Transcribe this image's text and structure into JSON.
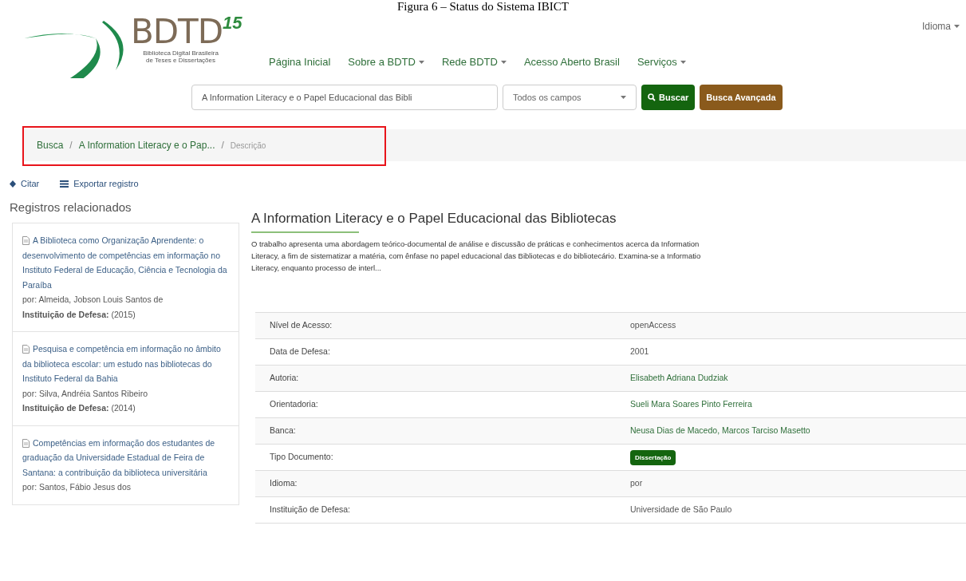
{
  "caption": "Figura 6 – Status do Sistema IBICT",
  "logo": {
    "name": "BDTD",
    "superscript": "15",
    "subtitle": [
      "Biblioteca Digital Brasileira",
      "de Teses e Dissertações"
    ]
  },
  "language_menu": {
    "label": "Idioma"
  },
  "nav": [
    {
      "label": "Página Inicial",
      "dropdown": false
    },
    {
      "label": "Sobre a BDTD",
      "dropdown": true
    },
    {
      "label": "Rede BDTD",
      "dropdown": true
    },
    {
      "label": "Acesso Aberto Brasil",
      "dropdown": false
    },
    {
      "label": "Serviços",
      "dropdown": true
    }
  ],
  "search": {
    "value": "A Information Literacy e o Papel Educacional das Bibli",
    "field": "Todos os campos",
    "search_button": "Buscar",
    "advanced_button": "Busca Avançada"
  },
  "breadcrumb": [
    {
      "label": "Busca",
      "link": true
    },
    {
      "label": "A Information Literacy e o Pap...",
      "link": true
    },
    {
      "label": "Descrição",
      "link": false
    }
  ],
  "breadcrumb_separator": "/",
  "highlight": {
    "kind": "box",
    "color": "#e8141b"
  },
  "actions": [
    {
      "label": "Citar",
      "kind": "cite"
    },
    {
      "label": "Exportar registro",
      "kind": "export"
    }
  ],
  "related": {
    "title": "Registros relacionados",
    "items": [
      {
        "title": "A Biblioteca como Organização Aprendente: o desenvolvimento de competências em informação no Instituto Federal de Educação, Ciência e Tecnologia da Paraíba",
        "author": "por: Almeida, Jobson Louis Santos de",
        "institution_label": "Instituição de Defesa:",
        "year": "(2015)"
      },
      {
        "title": "Pesquisa e competência em informação no âmbito da biblioteca escolar: um estudo nas bibliotecas do Instituto Federal da Bahia",
        "author": "por: Silva, Andréia Santos Ribeiro",
        "institution_label": "Instituição de Defesa:",
        "year": "(2014)"
      },
      {
        "title": "Competências em informação dos estudantes de graduação da Universidade Estadual de Feira de Santana: a contribuição da biblioteca universitária",
        "author": "por: Santos, Fábio Jesus dos"
      }
    ]
  },
  "record": {
    "title": "A Information Literacy e o Papel Educacional das Bibliotecas",
    "abstract_lines": [
      "O trabalho apresenta uma abordagem teórico-documental de análise e discussão de práticas e conhecimentos acerca da Information",
      "Literacy, a fim de sistematizar a matéria, com ênfase no papel educacional das Bibliotecas e do bibliotecário. Examina-se a Informatio",
      "Literacy, enquanto processo de interl..."
    ],
    "fields": [
      {
        "label": "Nível de Acesso:",
        "value": "openAccess",
        "kind": "text"
      },
      {
        "label": "Data de Defesa:",
        "value": "2001",
        "kind": "text"
      },
      {
        "label": "Autoria:",
        "value": "Elisabeth Adriana Dudziak",
        "kind": "link"
      },
      {
        "label": "Orientadoria:",
        "value": "Sueli Mara Soares Pinto Ferreira",
        "kind": "link"
      },
      {
        "label": "Banca:",
        "value": "Neusa Dias de Macedo, Marcos Tarciso Masetto",
        "kind": "link"
      },
      {
        "label": "Tipo Documento:",
        "value": "Dissertação",
        "kind": "badge"
      },
      {
        "label": "Idioma:",
        "value": "por",
        "kind": "text"
      },
      {
        "label": "Instituição de Defesa:",
        "value": "Universidade de São Paulo",
        "kind": "text"
      }
    ]
  }
}
